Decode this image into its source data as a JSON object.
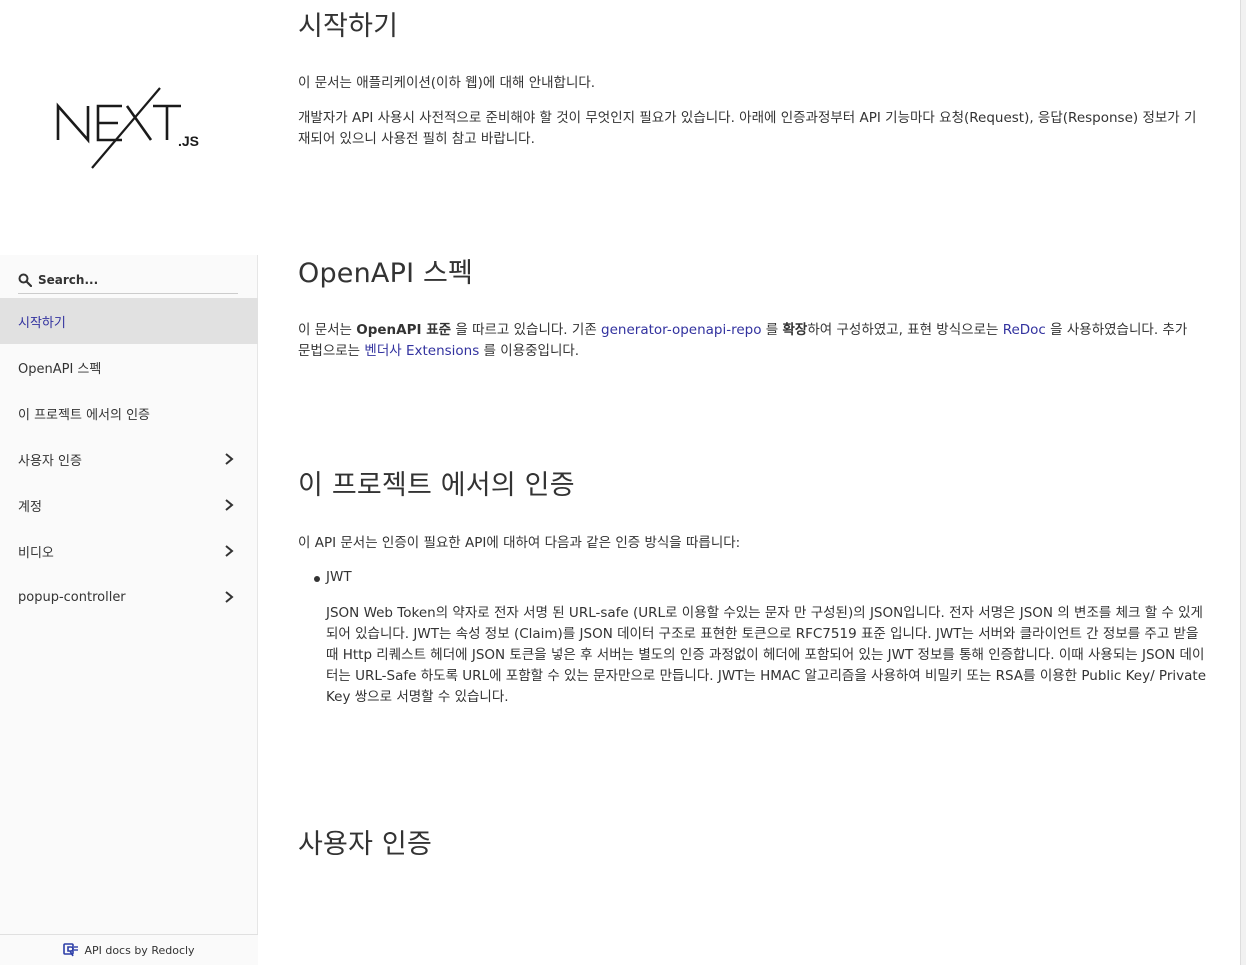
{
  "sidebar": {
    "logo_alt": "NEXT.JS",
    "logo_main": "NEXT",
    "logo_suffix": ".JS",
    "search": {
      "placeholder": "Search..."
    },
    "items": [
      {
        "label": "시작하기",
        "active": true,
        "expandable": false
      },
      {
        "label": "OpenAPI 스펙",
        "active": false,
        "expandable": false
      },
      {
        "label": "이 프로젝트 에서의 인증",
        "active": false,
        "expandable": false
      },
      {
        "label": "사용자 인증",
        "active": false,
        "expandable": true
      },
      {
        "label": "계정",
        "active": false,
        "expandable": true
      },
      {
        "label": "비디오",
        "active": false,
        "expandable": true
      },
      {
        "label": "popup-controller",
        "active": false,
        "expandable": true
      }
    ],
    "footer": "API docs by Redocly"
  },
  "content": {
    "s1": {
      "title": "시작하기",
      "p1": "이 문서는 애플리케이션(이하 웹)에 대해 안내합니다.",
      "p2": "개발자가 API 사용시 사전적으로 준비해야 할 것이 무엇인지 필요가 있습니다. 아래에 인증과정부터 API 기능마다 요청(Request), 응답(Response) 정보가 기재되어 있으니 사용전 필히 참고 바랍니다."
    },
    "s2": {
      "title": "OpenAPI 스펙",
      "t1": "이 문서는 ",
      "b1": "OpenAPI 표준",
      "t2": " 을 따르고 있습니다. 기존 ",
      "link1": "generator-openapi-repo",
      "t3": " 를 ",
      "b2": "확장",
      "t4": "하여 구성하였고, 표현 방식으로는 ",
      "link2": "ReDoc",
      "t5": " 을 사용하였습니다. 추가 문법으로는 ",
      "link3": "벤더사 Extensions",
      "t6": " 를 이용중입니다."
    },
    "s3": {
      "title": "이 프로젝트 에서의 인증",
      "p1": "이 API 문서는 인증이 필요한 API에 대하여 다음과 같은 인증 방식을 따릅니다:",
      "bullet": "JWT",
      "desc": "JSON Web Token의 약자로 전자 서명 된 URL-safe (URL로 이용할 수있는 문자 만 구성된)의 JSON입니다. 전자 서명은 JSON 의 변조를 체크 할 수 있게되어 있습니다. JWT는 속성 정보 (Claim)를 JSON 데이터 구조로 표현한 토큰으로 RFC7519 표준 입니다. JWT는 서버와 클라이언트 간 정보를 주고 받을 때 Http 리퀘스트 헤더에 JSON 토큰을 넣은 후 서버는 별도의 인증 과정없이 헤더에 포함되어 있는 JWT 정보를 통해 인증합니다. 이때 사용되는 JSON 데이터는 URL-Safe 하도록 URL에 포함할 수 있는 문자만으로 만듭니다. JWT는 HMAC 알고리즘을 사용하여 비밀키 또는 RSA를 이용한 Public Key/ Private Key 쌍으로 서명할 수 있습니다."
    },
    "s4": {
      "title": "사용자 인증"
    }
  },
  "colors": {
    "accent": "#32329f",
    "active_bg": "#e1e1e1",
    "sidebar_bg": "#fafafa",
    "text": "#333333"
  }
}
